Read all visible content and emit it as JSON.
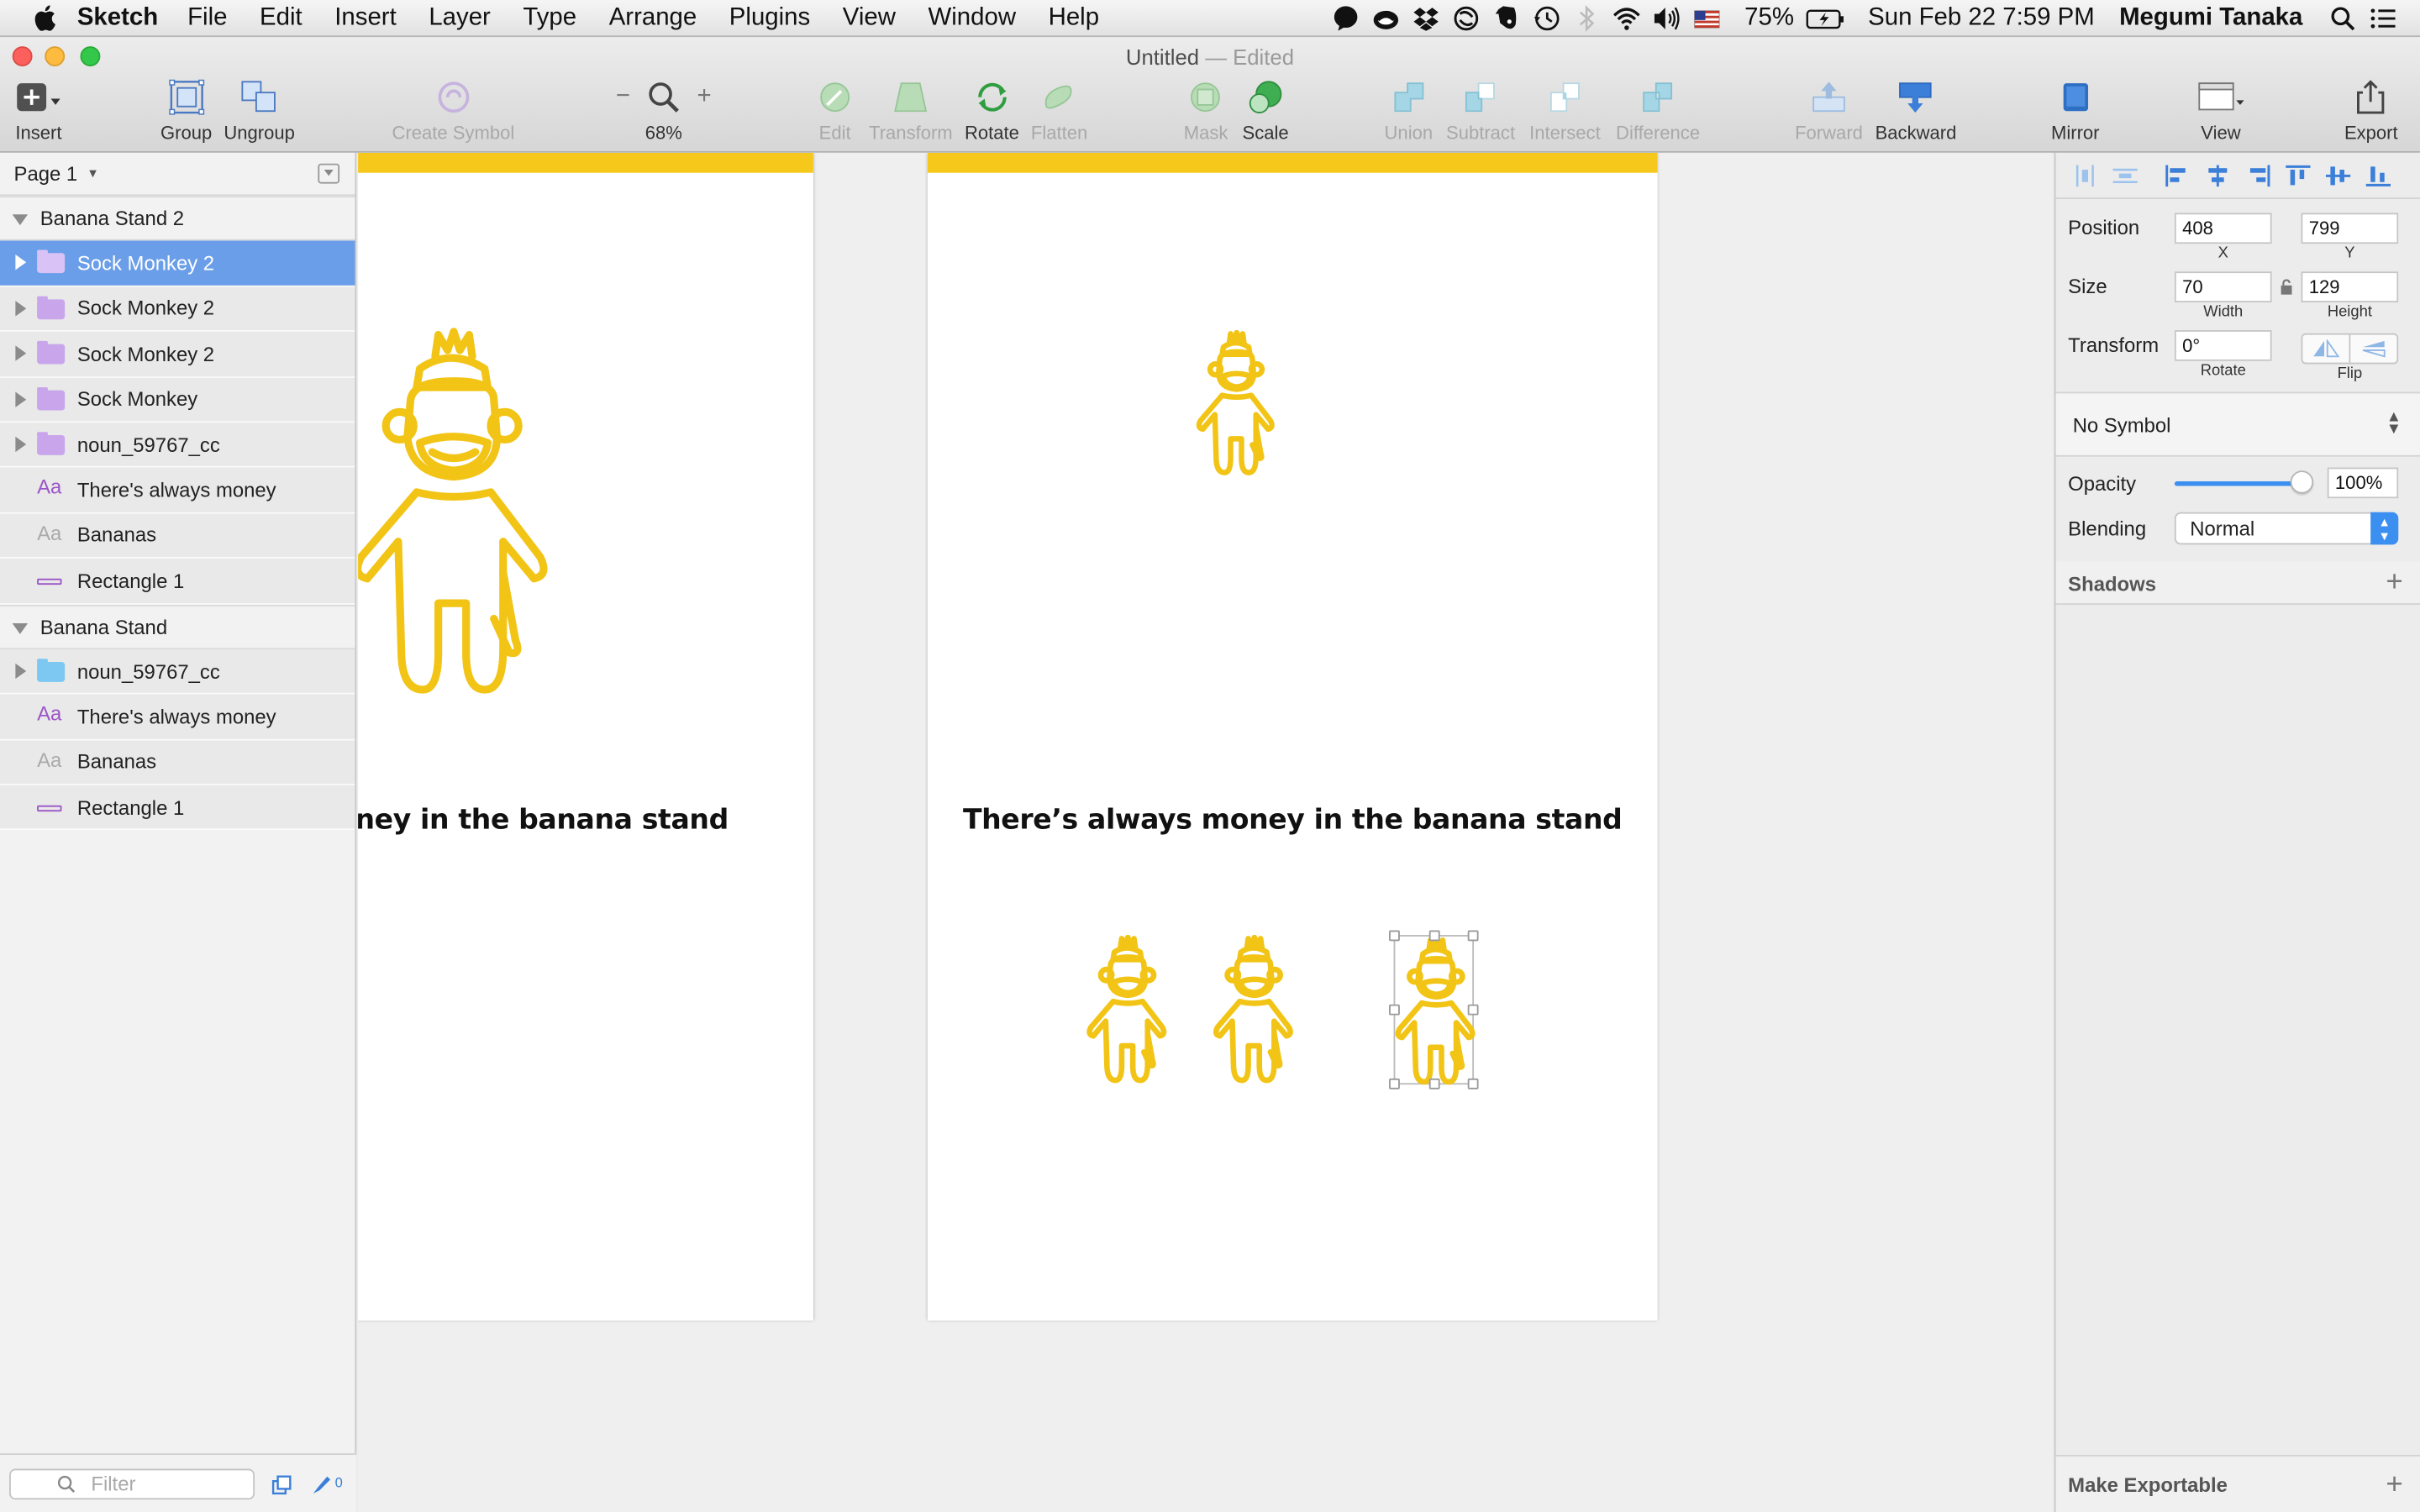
{
  "menubar": {
    "app_name": "Sketch",
    "menus": [
      "File",
      "Edit",
      "Insert",
      "Layer",
      "Type",
      "Arrange",
      "Plugins",
      "View",
      "Window",
      "Help"
    ],
    "battery": "75%",
    "datetime": "Sun Feb 22  7:59 PM",
    "user": "Megumi Tanaka",
    "status_icons": [
      "speech-bubble-icon",
      "creative-cloud-icon",
      "dropbox-icon",
      "sync-icon",
      "evernote-icon",
      "time-machine-icon",
      "bluetooth-icon",
      "wifi-icon",
      "volume-icon",
      "us-flag-icon",
      "battery-icon",
      "spotlight-icon",
      "notification-center-icon"
    ]
  },
  "window": {
    "title": "Untitled",
    "status": "— Edited"
  },
  "toolbar": {
    "insert": "Insert",
    "group": "Group",
    "ungroup": "Ungroup",
    "create_symbol": "Create Symbol",
    "zoom": "68%",
    "zoom_minus": "−",
    "zoom_plus": "+",
    "edit": "Edit",
    "transform": "Transform",
    "rotate": "Rotate",
    "flatten": "Flatten",
    "mask": "Mask",
    "scale": "Scale",
    "union": "Union",
    "subtract": "Subtract",
    "intersect": "Intersect",
    "difference": "Difference",
    "forward": "Forward",
    "backward": "Backward",
    "mirror": "Mirror",
    "view": "View",
    "export": "Export"
  },
  "sidebar": {
    "page": "Page 1",
    "groups": [
      {
        "name": "Banana Stand 2",
        "layers": [
          {
            "name": "Sock Monkey 2",
            "kind": "folder",
            "selected": true
          },
          {
            "name": "Sock Monkey 2",
            "kind": "folder"
          },
          {
            "name": "Sock Monkey 2",
            "kind": "folder"
          },
          {
            "name": "Sock Monkey",
            "kind": "folder"
          },
          {
            "name": "noun_59767_cc",
            "kind": "folder"
          },
          {
            "name": "There's always money",
            "kind": "text"
          },
          {
            "name": "Bananas",
            "kind": "text"
          },
          {
            "name": "Rectangle 1",
            "kind": "rect"
          }
        ]
      },
      {
        "name": "Banana Stand",
        "layers": [
          {
            "name": "noun_59767_cc",
            "kind": "folder"
          },
          {
            "name": "There's always money",
            "kind": "text"
          },
          {
            "name": "Bananas",
            "kind": "text"
          },
          {
            "name": "Rectangle 1",
            "kind": "rect"
          }
        ]
      }
    ],
    "filter_placeholder": "Filter",
    "badge_count": "0"
  },
  "canvas": {
    "left_artboard_text": "s money in the banana stand",
    "right_artboard_text": "There’s always money in the banana stand",
    "accent": "#f6c81c"
  },
  "inspector": {
    "position_label": "Position",
    "x": "408",
    "y": "799",
    "x_label": "X",
    "y_label": "Y",
    "size_label": "Size",
    "width": "70",
    "height": "129",
    "width_label": "Width",
    "height_label": "Height",
    "transform_label": "Transform",
    "rotate_value": "0°",
    "rotate_label": "Rotate",
    "flip_label": "Flip",
    "symbol": "No Symbol",
    "opacity_label": "Opacity",
    "opacity_value": "100%",
    "opacity_level": 1.0,
    "blending_label": "Blending",
    "blending_value": "Normal",
    "shadows_label": "Shadows",
    "exportable_label": "Make Exportable"
  }
}
